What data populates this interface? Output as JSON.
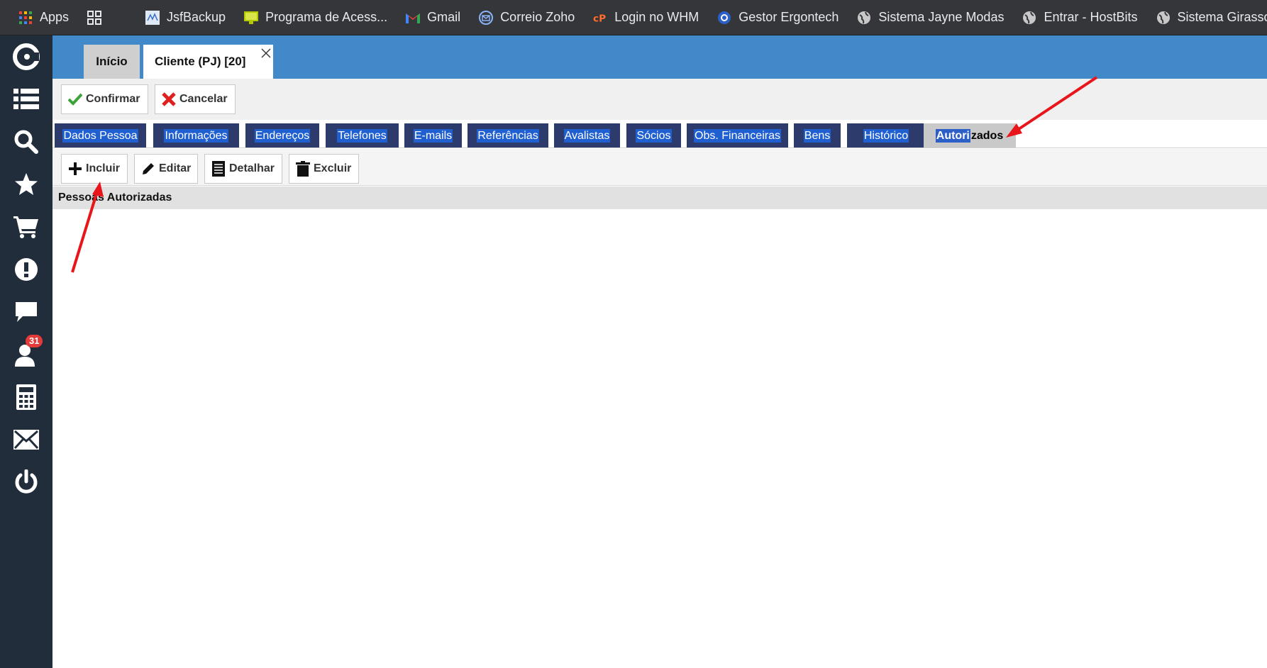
{
  "bookmarks": {
    "items": [
      {
        "label": "Apps"
      },
      {
        "label": "JsfBackup"
      },
      {
        "label": "Programa de Acess..."
      },
      {
        "label": "Gmail"
      },
      {
        "label": "Correio Zoho"
      },
      {
        "label": "Login no WHM"
      },
      {
        "label": "Gestor Ergontech"
      },
      {
        "label": "Sistema Jayne Modas"
      },
      {
        "label": "Entrar - HostBits"
      },
      {
        "label": "Sistema Girassol"
      }
    ]
  },
  "sidebar": {
    "icons": [
      "logo-icon",
      "list-icon",
      "search-icon",
      "star-icon",
      "cart-icon",
      "alert-icon",
      "chat-icon",
      "user-icon",
      "calculator-icon",
      "mail-icon",
      "power-icon"
    ],
    "badge": "31"
  },
  "page_tabs": {
    "inicio": "Início",
    "cliente": "Cliente (PJ) [20]"
  },
  "actions": {
    "confirm": "Confirmar",
    "cancel": "Cancelar"
  },
  "subtabs": {
    "items": [
      "Dados Pessoa",
      "Informações",
      "Endereços",
      "Telefones",
      "E-mails",
      "Referências",
      "Avalistas",
      "Sócios",
      "Obs. Financeiras",
      "Bens",
      "Histórico"
    ],
    "active_selected": "Autori",
    "active_rest": "zados"
  },
  "toolbar": {
    "include": "Incluir",
    "edit": "Editar",
    "detail": "Detalhar",
    "delete": "Excluir"
  },
  "section": {
    "title": "Pessoas Autorizadas"
  },
  "colors": {
    "topbar": "#4189c9",
    "sidebar": "#222d3c",
    "subtab": "#2c3b6b",
    "annotation_arrow": "#e8161b"
  }
}
